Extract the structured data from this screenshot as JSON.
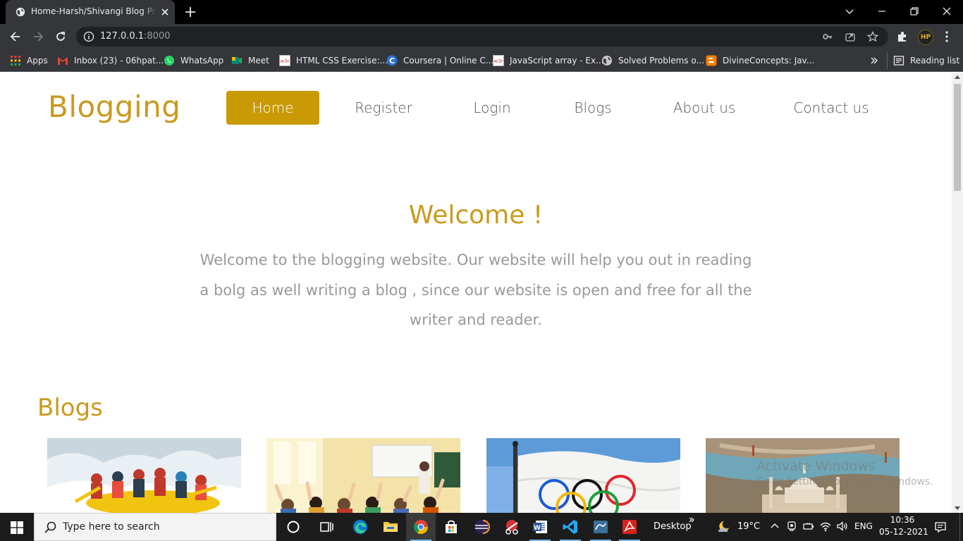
{
  "browser": {
    "tab_title": "Home-Harsh/Shivangi Blog Project",
    "url_host": "127.0.0.1",
    "url_port": ":8000",
    "profile_initials": "HP",
    "bookmarks": [
      {
        "label": "Apps",
        "icon": "apps-grid-icon",
        "color": "#e94235"
      },
      {
        "label": "Inbox (23) - 06hpat...",
        "icon": "gmail-icon",
        "color": "#ea4335"
      },
      {
        "label": "WhatsApp",
        "icon": "whatsapp-icon",
        "color": "#25d366"
      },
      {
        "label": "Meet",
        "icon": "meet-icon",
        "color": "#00897b"
      },
      {
        "label": "HTML CSS Exercise:...",
        "icon": "w3r-icon",
        "color": "#ffffff"
      },
      {
        "label": "Coursera | Online C...",
        "icon": "coursera-icon",
        "color": "#2a73cc"
      },
      {
        "label": "JavaScript array - Ex...",
        "icon": "w3r-icon",
        "color": "#ffffff"
      },
      {
        "label": "Solved Problems o...",
        "icon": "globe-icon",
        "color": "#c8c8c8"
      },
      {
        "label": "DivineConcepts: Jav...",
        "icon": "blogger-icon",
        "color": "#f57d00"
      }
    ],
    "reading_list": "Reading list"
  },
  "site": {
    "brand": "Blogging",
    "nav": [
      "Home",
      "Register",
      "Login",
      "Blogs",
      "About us",
      "Contact us"
    ],
    "accent": "#c99a06",
    "welcome_title": "Welcome !",
    "welcome_text": "Welcome to the blogging website. Our website will help you out in reading a bolg as well writing a blog , since our website is open and free for all the writer and reader.",
    "blogs_heading": "Blogs",
    "blog_cards": [
      "rafting-photo",
      "classroom-photo",
      "olympic-flag-photo",
      "taj-mahal-photo"
    ]
  },
  "watermark": {
    "line1": "Activate Windows",
    "line2": "Go to Settings to activate Windows."
  },
  "taskbar": {
    "search_placeholder": "Type here to search",
    "desktop_label": "Desktop",
    "weather": "19°C",
    "language": "ENG",
    "time": "10:36",
    "date": "05-12-2021"
  }
}
